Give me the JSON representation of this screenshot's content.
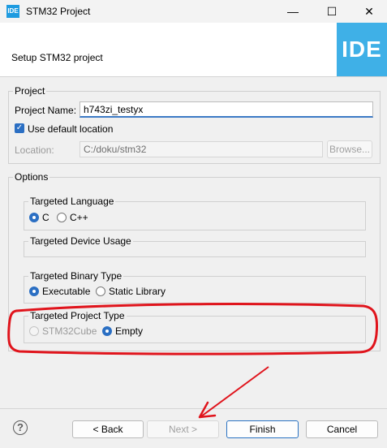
{
  "window": {
    "title": "STM32 Project",
    "app_icon_text": "IDE",
    "minimize": "—",
    "maximize": "☐",
    "close": "✕"
  },
  "header": {
    "subtitle": "Setup STM32 project",
    "logo_text": "IDE",
    "logo_color": "#3fb0e7"
  },
  "project": {
    "group_label": "Project",
    "name_label": "Project Name:",
    "name_value": "h743zi_testyx",
    "use_default_label": "Use default location",
    "use_default_checked": true,
    "location_label": "Location:",
    "location_value": "C:/doku/stm32",
    "browse_label": "Browse..."
  },
  "options": {
    "group_label": "Options",
    "language": {
      "label": "Targeted Language",
      "c": "C",
      "cpp": "C++",
      "selected": "C"
    },
    "device_usage": {
      "label": "Targeted Device Usage"
    },
    "binary": {
      "label": "Targeted Binary Type",
      "exe": "Executable",
      "static": "Static Library",
      "selected": "Executable"
    },
    "project_type": {
      "label": "Targeted Project Type",
      "cube": "STM32Cube",
      "empty": "Empty",
      "selected": "Empty"
    }
  },
  "buttons": {
    "help": "?",
    "back": "< Back",
    "next": "Next >",
    "finish": "Finish",
    "cancel": "Cancel"
  },
  "annotation_color": "#e0141c"
}
